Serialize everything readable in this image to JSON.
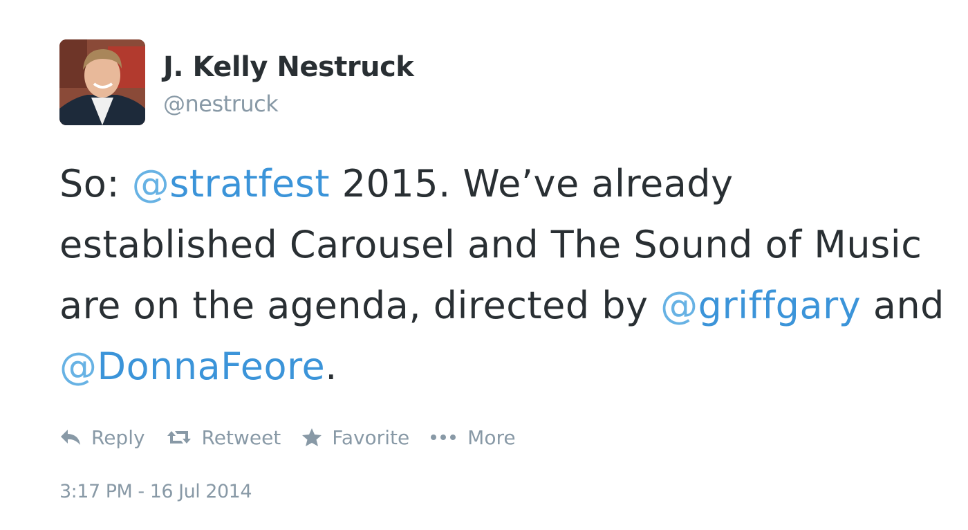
{
  "author": {
    "display_name": "J. Kelly Nestruck",
    "screen_name": "@nestruck"
  },
  "tweet": {
    "text_parts": {
      "p0": "So: ",
      "m1_at": "@",
      "m1_name": "stratfest",
      "p1": " 2015. We’ve already established Carousel and The Sound of Music are on the agenda, directed by ",
      "m2_at": "@",
      "m2_name": "griffgary",
      "p2": " and ",
      "m3_at": "@",
      "m3_name": "DonnaFeore",
      "p3": "."
    },
    "timestamp": "3:17 PM - 16 Jul 2014"
  },
  "actions": {
    "reply": {
      "label": "Reply",
      "icon": "reply-icon"
    },
    "retweet": {
      "label": "Retweet",
      "icon": "retweet-icon"
    },
    "favorite": {
      "label": "Favorite",
      "icon": "star-icon"
    },
    "more": {
      "label": "More",
      "icon": "more-dots-icon"
    }
  },
  "colors": {
    "text": "#292f33",
    "muted": "#8899a6",
    "link": "#3b94d9"
  }
}
